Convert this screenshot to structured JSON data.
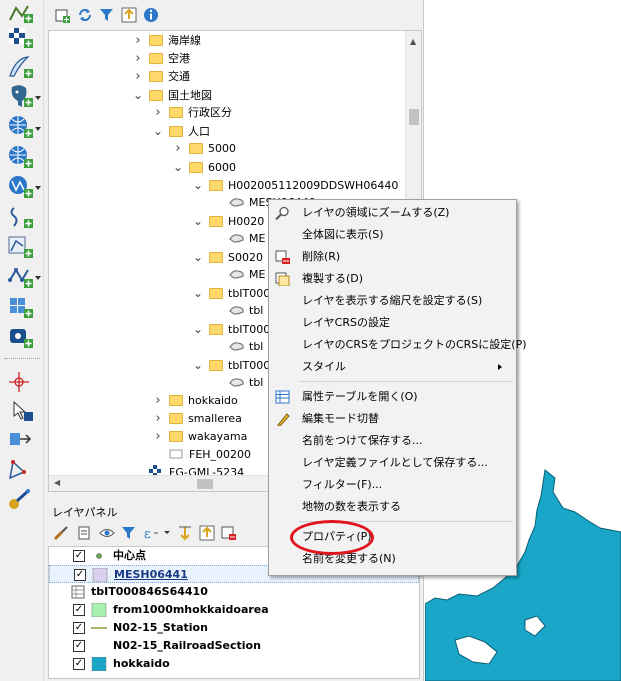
{
  "browser": {
    "tree": [
      {
        "label": "海岸線",
        "depth": 0,
        "expander": "collapsed"
      },
      {
        "label": "空港",
        "depth": 0,
        "expander": "collapsed"
      },
      {
        "label": "交通",
        "depth": 0,
        "expander": "collapsed"
      },
      {
        "label": "国土地図",
        "depth": 0,
        "expander": "expanded"
      },
      {
        "label": "行政区分",
        "depth": 1,
        "expander": "collapsed"
      },
      {
        "label": "人口",
        "depth": 1,
        "expander": "expanded"
      },
      {
        "label": "5000",
        "depth": 2,
        "expander": "collapsed"
      },
      {
        "label": "6000",
        "depth": 2,
        "expander": "expanded"
      },
      {
        "label": "H002005112009DDSWH06440",
        "depth": 3,
        "expander": "expanded"
      },
      {
        "label": "MESH06440",
        "depth": 4,
        "expander": "none"
      },
      {
        "label": "H0020",
        "depth": 3,
        "expander": "expanded"
      },
      {
        "label": "ME",
        "depth": 4,
        "expander": "none"
      },
      {
        "label": "S0020",
        "depth": 3,
        "expander": "expanded"
      },
      {
        "label": "ME",
        "depth": 4,
        "expander": "none"
      },
      {
        "label": "tbIT000",
        "depth": 3,
        "expander": "expanded"
      },
      {
        "label": "tbl",
        "depth": 4,
        "expander": "none"
      },
      {
        "label": "tbIT000",
        "depth": 3,
        "expander": "expanded"
      },
      {
        "label": "tbl",
        "depth": 4,
        "expander": "none"
      },
      {
        "label": "tbIT000",
        "depth": 3,
        "expander": "expanded"
      },
      {
        "label": "tbl",
        "depth": 4,
        "expander": "none"
      },
      {
        "label": "hokkaido",
        "depth": 1,
        "expander": "collapsed"
      },
      {
        "label": "smallerea",
        "depth": 1,
        "expander": "collapsed"
      },
      {
        "label": "wakayama",
        "depth": 1,
        "expander": "collapsed"
      },
      {
        "label": "FEH_00200",
        "depth": 1,
        "expander": "none"
      },
      {
        "label": "FG-GML-5234",
        "depth": 0,
        "expander": "none"
      }
    ]
  },
  "layer_panel": {
    "title": "レイヤパネル",
    "layers": [
      {
        "name": "中心点",
        "checkbox": "✓",
        "symbol": "point",
        "color": "#6aaa50"
      },
      {
        "name": "MESH06441",
        "checkbox": "✓",
        "symbol": "polygon",
        "color": "#d8d0ee",
        "selected": true
      },
      {
        "name": "tbIT000846S64410",
        "checkbox": "",
        "symbol": "table",
        "color": "#888888"
      },
      {
        "name": "from1000mhokkaidoarea",
        "checkbox": "✓",
        "symbol": "polygon",
        "color": "#a8f0b0"
      },
      {
        "name": "N02-15_Station",
        "checkbox": "✓",
        "symbol": "line",
        "color": "#8aa030"
      },
      {
        "name": "N02-15_RailroadSection",
        "checkbox": "✓",
        "symbol": "line",
        "color": "#ffffff"
      },
      {
        "name": "hokkaido",
        "checkbox": "✓",
        "symbol": "polygon",
        "color": "#1aa6c8"
      }
    ]
  },
  "context_menu": {
    "items": [
      {
        "label": "レイヤの領域にズームする(Z)",
        "icon": "zoom-icon"
      },
      {
        "label": "全体図に表示(S)",
        "icon": ""
      },
      {
        "label": "削除(R)",
        "icon": "remove-layer-icon"
      },
      {
        "label": "複製する(D)",
        "icon": "duplicate-layer-icon"
      },
      {
        "label": "レイヤを表示する縮尺を設定する(S)",
        "icon": ""
      },
      {
        "label": "レイヤCRSの設定",
        "icon": ""
      },
      {
        "label": "レイヤのCRSをプロジェクトのCRSに設定(P)",
        "icon": ""
      },
      {
        "label": "スタイル",
        "icon": "",
        "submenu": true
      },
      {
        "separator": true
      },
      {
        "label": "属性テーブルを開く(O)",
        "icon": "attribute-table-icon"
      },
      {
        "label": "編集モード切替",
        "icon": "pencil-icon"
      },
      {
        "label": "名前をつけて保存する...",
        "icon": ""
      },
      {
        "label": "レイヤ定義ファイルとして保存する...",
        "icon": ""
      },
      {
        "label": "フィルター(F)...",
        "icon": ""
      },
      {
        "label": "地物の数を表示する",
        "icon": ""
      },
      {
        "separator": true
      },
      {
        "label": "プロパティ(P)",
        "icon": "",
        "highlight": true
      },
      {
        "label": "名前を変更する(N)",
        "icon": ""
      }
    ]
  },
  "colors": {
    "map_water": "#1aa6c8",
    "highlight_ring": "#e0141c"
  }
}
